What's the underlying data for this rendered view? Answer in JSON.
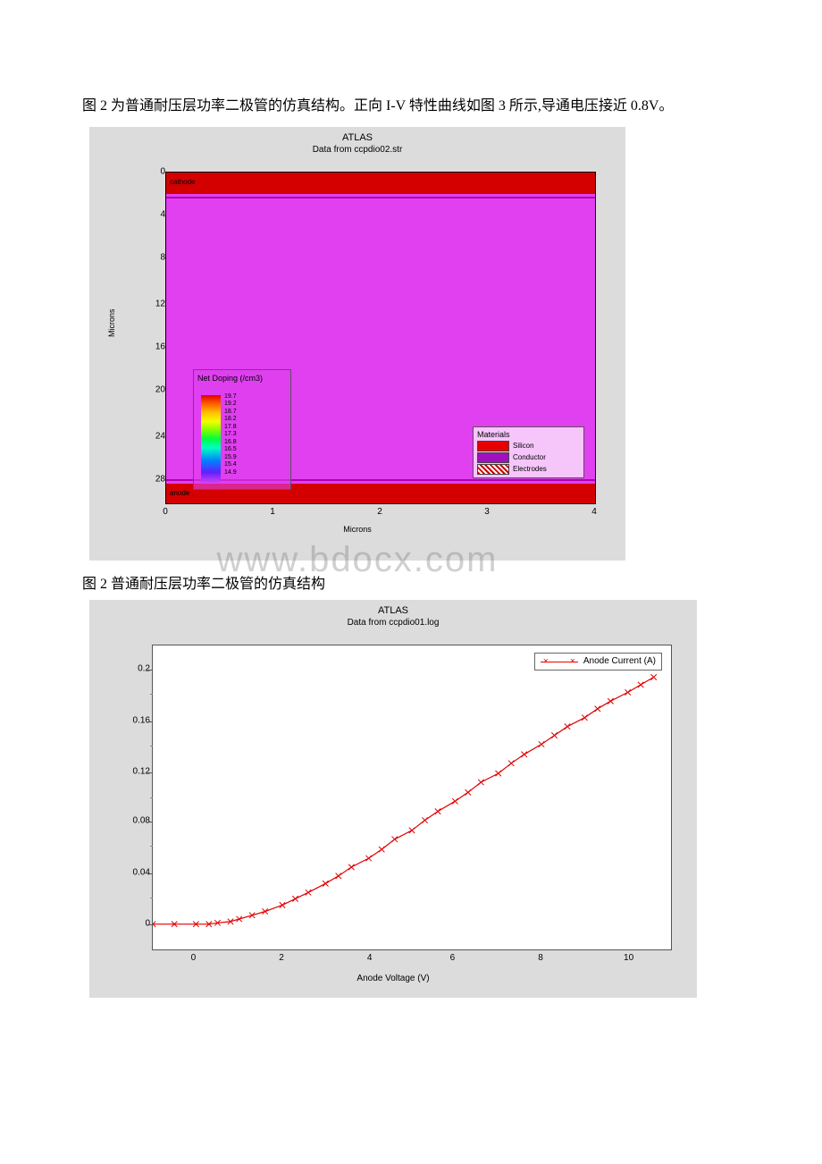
{
  "paragraph": "图 2 为普通耐压层功率二极管的仿真结构。正向 I-V 特性曲线如图 3 所示,导通电压接近 0.8V。",
  "caption_fig2": "图 2 普通耐压层功率二极管的仿真结构",
  "watermark": "www.bdocx.com",
  "fig1": {
    "software_title": "ATLAS",
    "subtitle": "Data from ccpdio02.str",
    "ylabel": "Microns",
    "xlabel": "Microns",
    "yticks": [
      "0",
      "4",
      "8",
      "12",
      "16",
      "20",
      "24",
      "28"
    ],
    "xticks": [
      "0",
      "1",
      "2",
      "3",
      "4"
    ],
    "region_cathode": "cathode",
    "region_anode": "anode",
    "doping_legend_title": "Net Doping (/cm3)",
    "doping_values": [
      "19.7",
      "19.2",
      "18.7",
      "18.2",
      "17.8",
      "17.3",
      "16.8",
      "16.5",
      "15.9",
      "15.4",
      "14.9"
    ],
    "materials_legend_title": "Materials",
    "mat_silicon": "Silicon",
    "mat_conductor": "Conductor",
    "mat_electrodes": "Electrodes"
  },
  "fig2": {
    "software_title": "ATLAS",
    "subtitle": "Data from ccpdio01.log",
    "legend": "Anode Current (A)",
    "xlabel": "Anode Voltage (V)",
    "yticks": [
      "0.2",
      "0.16",
      "0.12",
      "0.08",
      "0.04",
      "0"
    ],
    "xticks": [
      "0",
      "2",
      "4",
      "6",
      "8",
      "10"
    ]
  },
  "chart_data": {
    "type": "line",
    "title": "ATLAS — Data from ccpdio01.log",
    "xlabel": "Anode Voltage (V)",
    "ylabel": "Anode Current (A)",
    "xlim": [
      -1,
      11
    ],
    "ylim": [
      -0.02,
      0.22
    ],
    "series": [
      {
        "name": "Anode Current (A)",
        "x": [
          -1.0,
          -0.5,
          0.0,
          0.3,
          0.5,
          0.8,
          1.0,
          1.3,
          1.6,
          2.0,
          2.3,
          2.6,
          3.0,
          3.3,
          3.6,
          4.0,
          4.3,
          4.6,
          5.0,
          5.3,
          5.6,
          6.0,
          6.3,
          6.6,
          7.0,
          7.3,
          7.6,
          8.0,
          8.3,
          8.6,
          9.0,
          9.3,
          9.6,
          10.0,
          10.3,
          10.6
        ],
        "y": [
          0.0,
          0.0,
          0.0,
          0.0,
          0.001,
          0.002,
          0.004,
          0.007,
          0.01,
          0.015,
          0.02,
          0.025,
          0.032,
          0.038,
          0.045,
          0.052,
          0.059,
          0.067,
          0.074,
          0.082,
          0.089,
          0.097,
          0.104,
          0.112,
          0.119,
          0.127,
          0.134,
          0.142,
          0.149,
          0.156,
          0.163,
          0.17,
          0.176,
          0.183,
          0.189,
          0.195
        ]
      }
    ]
  }
}
